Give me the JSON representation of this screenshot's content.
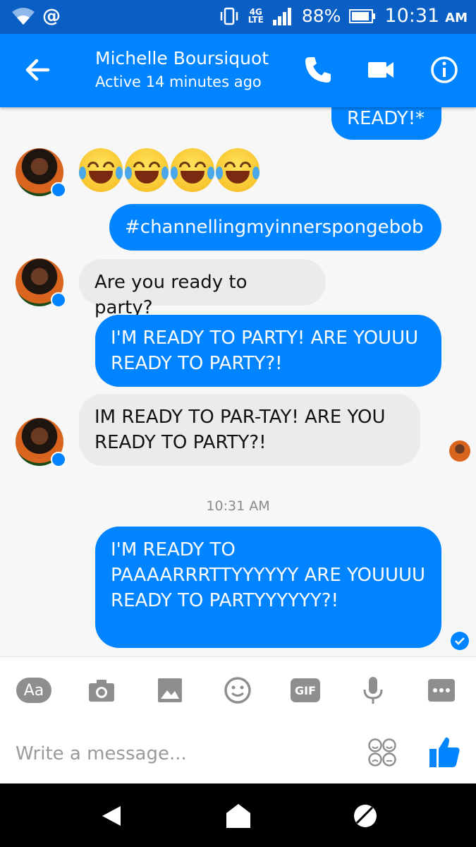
{
  "status_bar": {
    "at_symbol": "@",
    "network_top": "4G",
    "network_bottom": "LTE",
    "battery": "88%",
    "time": "10:31",
    "ampm": "AM"
  },
  "header": {
    "contact_name": "Michelle Boursiquot",
    "status": "Active 14 minutes ago"
  },
  "messages": [
    {
      "sender": "me",
      "text": "READY!*"
    },
    {
      "sender": "contact",
      "emoji": "tears-of-joy x4"
    },
    {
      "sender": "me",
      "text": "#channellingmyinnerspongebob"
    },
    {
      "sender": "contact",
      "text": "Are you ready to party?"
    },
    {
      "sender": "me",
      "text": "I'M READY TO PARTY! ARE YOUUU READY TO PARTY?!"
    },
    {
      "sender": "contact",
      "text": "IM READY TO PAR-TAY! ARE YOU READY TO PARTY?!"
    },
    {
      "sender": "me",
      "text": "I'M READY TO PAAAARRRTTYYYYYY ARE YOUUUU READY TO PARTYYYYYY?!"
    }
  ],
  "timestamp": "10:31 AM",
  "composer": {
    "aa_label": "Aa",
    "gif_label": "GIF",
    "placeholder": "Write a message..."
  },
  "colors": {
    "accent": "#0084ff",
    "status_bar": "#0a5fc4",
    "incoming_bubble": "#ebebeb"
  }
}
